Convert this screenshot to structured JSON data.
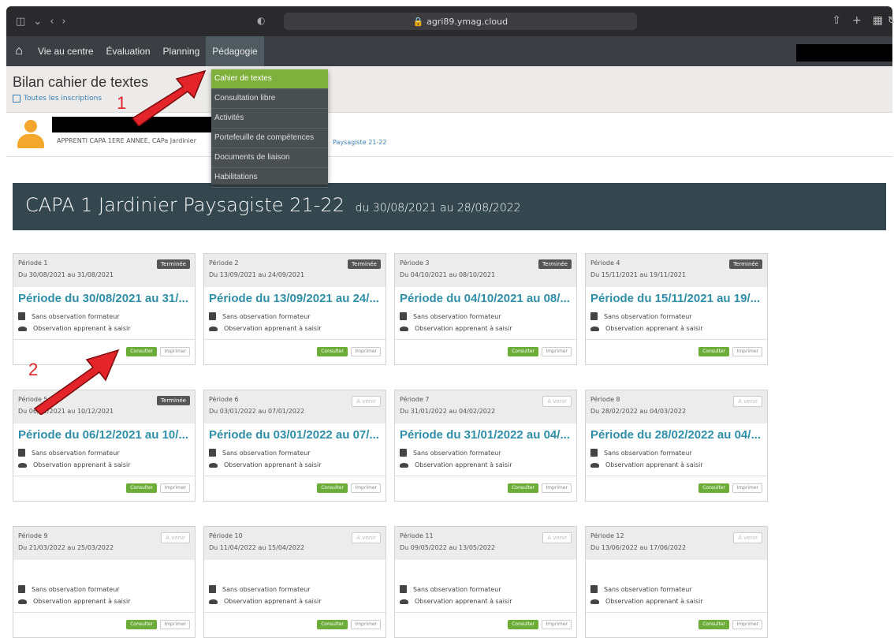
{
  "browser": {
    "url": "agri89.ymag.cloud"
  },
  "nav": {
    "items": [
      "Vie au centre",
      "Évaluation",
      "Planning",
      "Pédagogie"
    ]
  },
  "dropdown": {
    "items": [
      "Cahier de textes",
      "Consultation libre",
      "Activités",
      "Portefeuille de compétences",
      "Documents de liaison",
      "Habilitations"
    ]
  },
  "page": {
    "title": "Bilan cahier de textes",
    "all_inscriptions": "Toutes les inscriptions"
  },
  "user": {
    "info": "APPRENTI CAPA 1ERE ANNEE, CAPa Jardinier",
    "info_suffix": "Paysagiste 21-22"
  },
  "banner": {
    "title": "CAPA 1 Jardinier Paysagiste 21-22",
    "dates": "du 30/08/2021 au 28/08/2022"
  },
  "steps": [
    "1",
    "2"
  ],
  "labels": {
    "consult": "Consulter",
    "print": "Imprimer",
    "obs_formateur": "Sans observation formateur",
    "obs_apprenant": "Observation apprenant à saisir"
  },
  "periods": [
    {
      "label": "Période 1",
      "dates": "Du 30/08/2021 au 31/08/2021",
      "title": "Période du 30/08/2021 au 31/...",
      "status": "Terminée"
    },
    {
      "label": "Période 2",
      "dates": "Du 13/09/2021 au 24/09/2021",
      "title": "Période du 13/09/2021 au 24/...",
      "status": "Terminée"
    },
    {
      "label": "Période 3",
      "dates": "Du 04/10/2021 au 08/10/2021",
      "title": "Période du 04/10/2021 au 08/...",
      "status": "Terminée"
    },
    {
      "label": "Période 4",
      "dates": "Du 15/11/2021 au 19/11/2021",
      "title": "Période du 15/11/2021 au 19/...",
      "status": "Terminée"
    },
    {
      "label": "Période 5",
      "dates": "Du 06/12/2021 au 10/12/2021",
      "title": "Période du 06/12/2021 au 10/...",
      "status": "Terminée"
    },
    {
      "label": "Période 6",
      "dates": "Du 03/01/2022 au 07/01/2022",
      "title": "Période du 03/01/2022 au 07/...",
      "status": "A venir"
    },
    {
      "label": "Période 7",
      "dates": "Du 31/01/2022 au 04/02/2022",
      "title": "Période du 31/01/2022 au 04/...",
      "status": "A venir"
    },
    {
      "label": "Période 8",
      "dates": "Du 28/02/2022 au 04/03/2022",
      "title": "Période du 28/02/2022 au 04/...",
      "status": "A venir"
    },
    {
      "label": "Période 9",
      "dates": "Du 21/03/2022 au 25/03/2022",
      "title": "",
      "status": "A venir"
    },
    {
      "label": "Période 10",
      "dates": "Du 11/04/2022 au 15/04/2022",
      "title": "",
      "status": "A venir"
    },
    {
      "label": "Période 11",
      "dates": "Du 09/05/2022 au 13/05/2022",
      "title": "",
      "status": "A venir"
    },
    {
      "label": "Période 12",
      "dates": "Du 13/06/2022 au 17/06/2022",
      "title": "",
      "status": "A venir"
    }
  ]
}
